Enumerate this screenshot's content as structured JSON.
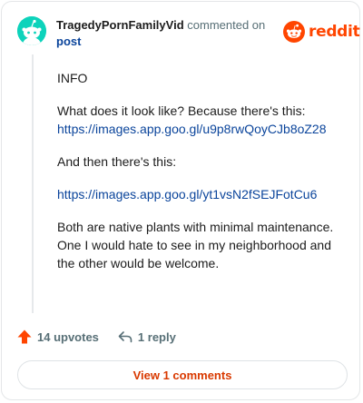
{
  "comment": {
    "author": "TragedyPornFamilyVid",
    "action": "commented on",
    "target_link": "post",
    "paragraphs": [
      {
        "text": "INFO",
        "link": ""
      },
      {
        "text": "What does it look like? Because there's this:",
        "link": "https://images.app.goo.gl/u9p8rwQoyCJb8oZ28"
      },
      {
        "text": "And then there's this:",
        "link": ""
      },
      {
        "text": "",
        "link": "https://images.app.goo.gl/yt1vsN2fSEJFotCu6"
      },
      {
        "text": "Both are native plants with minimal maintenance. One I would hate to see in my neighborhood and the other would be welcome.",
        "link": ""
      }
    ]
  },
  "brand": {
    "wordmark": "reddit",
    "color": "#ff4500"
  },
  "actions": {
    "upvotes": "14 upvotes",
    "replies": "1 reply"
  },
  "footer": {
    "view_comments": "View 1 comments"
  },
  "icons": {
    "avatar": "snoo-avatar-icon",
    "logo": "reddit-snoo-icon",
    "upvote": "upvote-arrow-icon",
    "reply": "reply-arrow-icon"
  }
}
